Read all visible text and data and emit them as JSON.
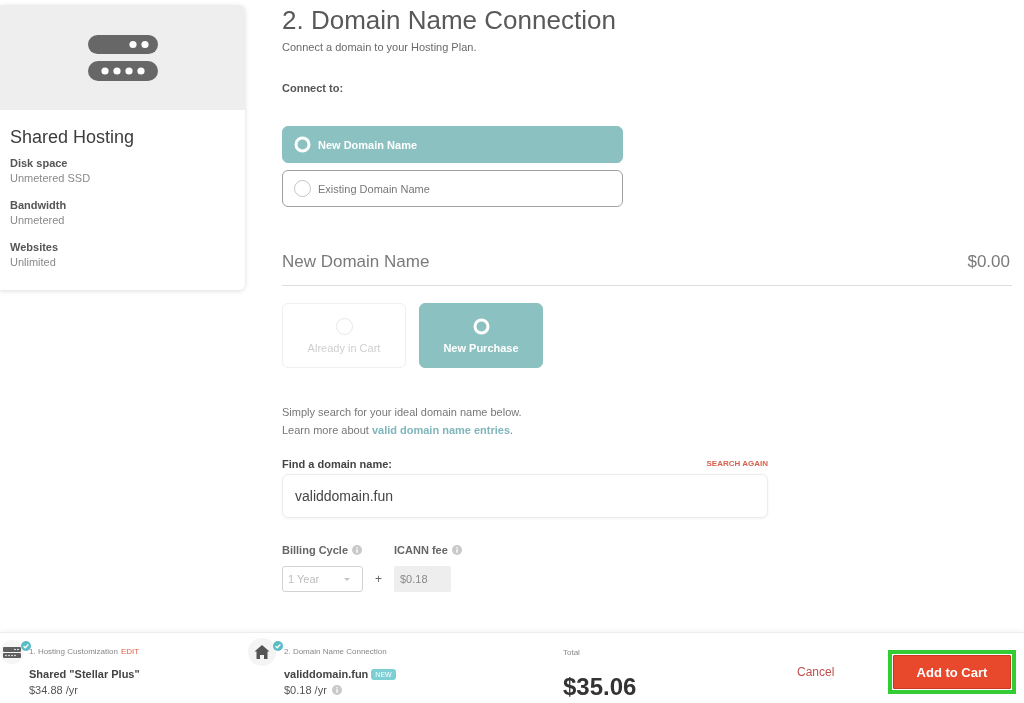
{
  "plan_card": {
    "title": "Shared Hosting",
    "specs": [
      {
        "label": "Disk space",
        "value": "Unmetered SSD"
      },
      {
        "label": "Bandwidth",
        "value": "Unmetered"
      },
      {
        "label": "Websites",
        "value": "Unlimited"
      }
    ]
  },
  "header": {
    "title": "2. Domain Name Connection",
    "subtitle": "Connect a domain to your Hosting Plan."
  },
  "connect": {
    "label": "Connect to:",
    "options": [
      {
        "label": "New Domain Name",
        "selected": true
      },
      {
        "label": "Existing Domain Name",
        "selected": false
      }
    ]
  },
  "domain": {
    "title": "New Domain Name",
    "price": "$0.00",
    "options": [
      {
        "label": "Already in Cart",
        "selected": false,
        "disabled": true
      },
      {
        "label": "New Purchase",
        "selected": true,
        "disabled": false
      }
    ],
    "help": "Simply search for your ideal domain name below.",
    "learn_more": {
      "text": "Learn more about",
      "link": "valid domain name entries",
      "end": "."
    }
  },
  "search": {
    "label": "Find a domain name:",
    "action": "SEARCH AGAIN",
    "value": "validdomain.fun"
  },
  "billing": {
    "cycle_label": "Billing Cycle",
    "cycle_value": "1 Year",
    "plus": "+",
    "fee_label": "ICANN fee",
    "fee_value": "$0.18"
  },
  "summary": {
    "steps": [
      {
        "kind": "hosting",
        "done": true,
        "caption": "1. Hosting Customization",
        "action": "EDIT",
        "name": "Shared \"Stellar Plus\"",
        "price": "$34.88 /yr"
      },
      {
        "kind": "domain",
        "done": true,
        "caption": "2. Domain Name Connection",
        "name": "validdomain.fun",
        "badge": "NEW",
        "price": "$0.18 /yr"
      }
    ],
    "total_label": "Total",
    "total": "$35.06",
    "cancel": "Cancel",
    "add_to_cart": {
      "label": "Add to Cart",
      "highlighted": true
    }
  }
}
